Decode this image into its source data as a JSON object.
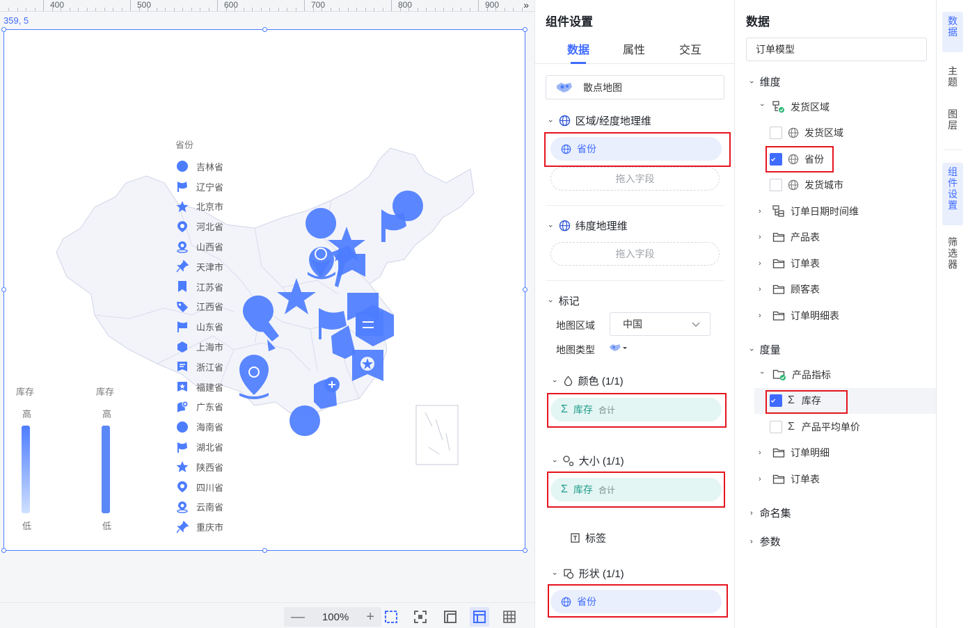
{
  "canvas": {
    "ruler_labels": [
      "400",
      "500",
      "600",
      "700",
      "800",
      "900"
    ],
    "coordinates": "359, 5",
    "legend": {
      "title": "省份",
      "items": [
        "吉林省",
        "辽宁省",
        "北京市",
        "河北省",
        "山西省",
        "天津市",
        "江苏省",
        "江西省",
        "山东省",
        "上海市",
        "浙江省",
        "福建省",
        "广东省",
        "海南省",
        "湖北省",
        "陕西省",
        "四川省",
        "云南省",
        "重庆市"
      ],
      "icons": [
        "circle-icon",
        "flag-icon",
        "star-icon",
        "map-pin-icon",
        "location-icon",
        "thumbtack-icon",
        "bookmark-icon",
        "tag-icon",
        "flag-wave-icon",
        "hexagon-icon",
        "message-icon",
        "star-badge-icon",
        "chat-pin-icon",
        "circle-icon",
        "flag-outline-icon",
        "star-icon",
        "map-pin-icon",
        "location-icon",
        "thumbtack-icon"
      ]
    },
    "color_legend": {
      "title": "库存",
      "high": "高",
      "low": "低"
    },
    "size_legend": {
      "title": "库存",
      "high": "高",
      "low": "低"
    },
    "zoom": "100%"
  },
  "settings": {
    "title": "组件设置",
    "tabs": [
      "数据",
      "属性",
      "交互"
    ],
    "chart_type": "散点地图",
    "region_section": "区域/经度地理维",
    "region_field": "省份",
    "drop_placeholder": "拖入字段",
    "latitude_section": "纬度地理维",
    "marks_section": "标记",
    "map_region_label": "地图区域",
    "map_region_value": "中国",
    "map_type_label": "地图类型",
    "color_section": "颜色 (1/1)",
    "color_field": "库存",
    "color_agg": "合计",
    "size_section": "大小 (1/1)",
    "size_field": "库存",
    "size_agg": "合计",
    "label_section": "标签",
    "shape_section": "形状 (1/1)",
    "shape_field": "省份"
  },
  "data_panel": {
    "title": "数据",
    "model": "订单模型",
    "dimensions_title": "维度",
    "dimensions": {
      "group": "发货区域",
      "children": [
        "发货区域",
        "省份",
        "发货城市"
      ],
      "others": [
        "订单日期时间维",
        "产品表",
        "订单表",
        "顾客表",
        "订单明细表"
      ]
    },
    "measures_title": "度量",
    "measures": {
      "group": "产品指标",
      "children": [
        "库存",
        "产品平均单价"
      ],
      "others": [
        "订单明细",
        "订单表"
      ]
    },
    "named_sets": "命名集",
    "parameters": "参数"
  },
  "rail": [
    "数据",
    "主题",
    "图层",
    "组件设置",
    "筛选器"
  ],
  "colors": {
    "accent": "#3f6bff",
    "marker": "#4d7dff",
    "highlight_border": "#e5141e",
    "measure_pill": "#e4f6f3",
    "dimension_pill": "#e9effd"
  }
}
